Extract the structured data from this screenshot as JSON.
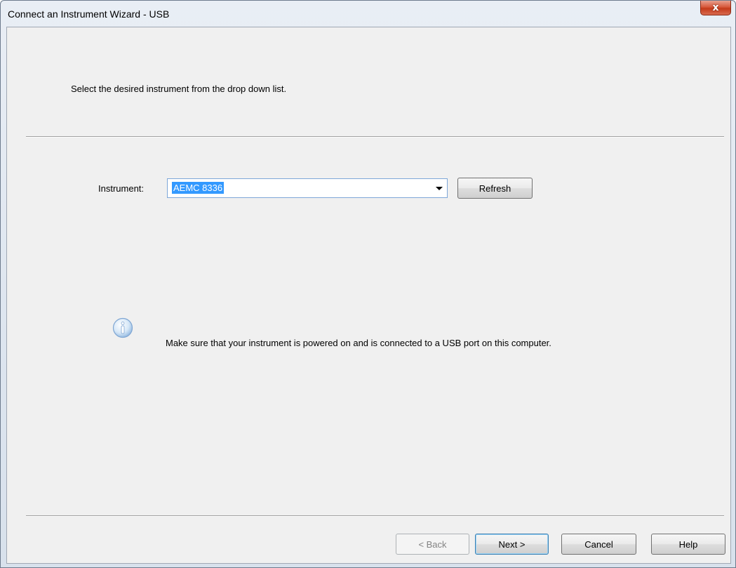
{
  "window": {
    "title": "Connect an Instrument Wizard - USB",
    "close_glyph": "x"
  },
  "page": {
    "instruction": "Select the desired instrument from the drop down list."
  },
  "instrument": {
    "label": "Instrument:",
    "selected": "AEMC 8336",
    "refresh_label": "Refresh"
  },
  "info": {
    "icon": "info-icon",
    "message": "Make sure that your instrument is powered on and is connected to a USB port on this computer."
  },
  "buttons": {
    "back": "< Back",
    "next": "Next >",
    "cancel": "Cancel",
    "help": "Help"
  },
  "colors": {
    "selection_highlight": "#3399ff",
    "close_button": "#c43a1a",
    "dialog_background": "#f0f0f0"
  }
}
